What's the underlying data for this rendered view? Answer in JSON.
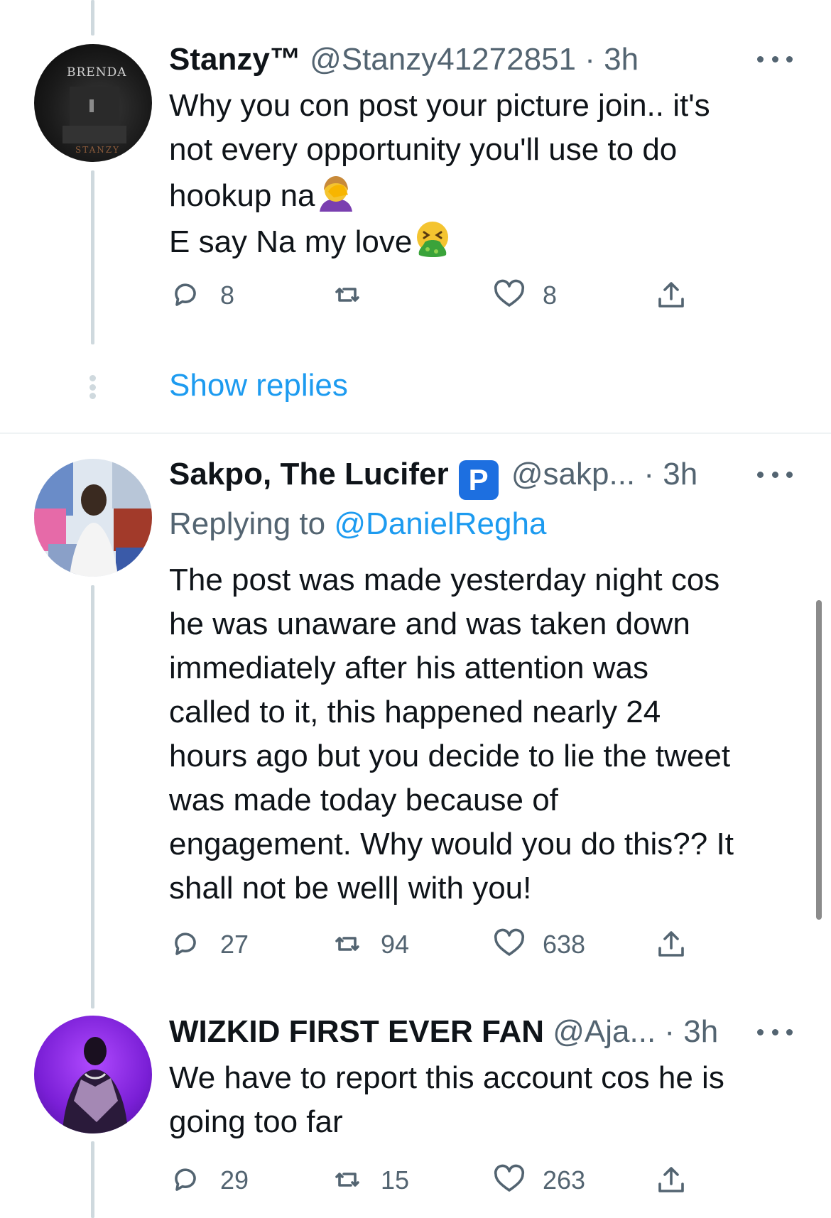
{
  "tweets": [
    {
      "name": "Stanzy™",
      "handle": "@Stanzy41272851",
      "time": "· 3h",
      "avatar_text_top": "BRENDA",
      "avatar_text_bottom": "STANZY",
      "lines": [
        "Why you con post your picture join.. it's",
        "not every opportunity you'll use to do",
        "hookup na",
        "E say Na my love"
      ],
      "emoji_1": "face-palm-emoji",
      "emoji_2": "vomiting-face-emoji",
      "replies": "8",
      "retweets": "",
      "likes": "8"
    },
    {
      "name": "Sakpo, The Lucifer",
      "badge": "P",
      "handle": "@sakp...",
      "time": "· 3h",
      "replying_prefix": "Replying to",
      "replying_handle": "@DanielRegha",
      "lines": [
        "The post was made yesterday night cos",
        "he was unaware and was taken down",
        "immediately after his attention was",
        "called to it, this happened nearly 24",
        "hours ago but you decide to lie the tweet",
        "was made today because of",
        "engagement. Why would you do this?? It",
        "shall not be well| with you!"
      ],
      "replies": "27",
      "retweets": "94",
      "likes": "638"
    },
    {
      "name": "WIZKID FIRST EVER FAN",
      "handle": "@Aja...",
      "time": "· 3h",
      "lines": [
        "We have to report this account cos he is",
        "going too far"
      ],
      "replies": "29",
      "retweets": "15",
      "likes": "263"
    }
  ],
  "show_replies": "Show replies",
  "colors": {
    "link": "#1d9bf0",
    "secondary": "#536471",
    "thread_line": "#cfd9de"
  }
}
